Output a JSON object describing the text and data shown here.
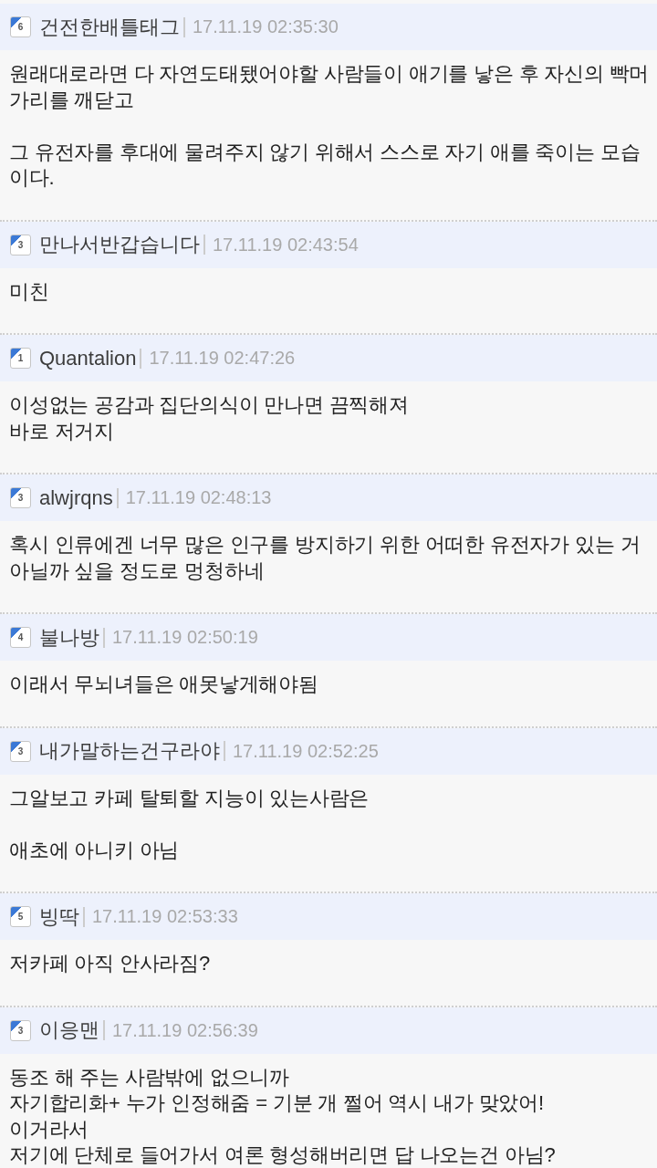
{
  "comments": [
    {
      "rank": "6",
      "author": "건전한배틀태그",
      "time": "17.11.19 02:35:30",
      "paragraphs": [
        [
          "원래대로라면 다 자연도태됐어야할 사람들이 애기를 낳은 후 자신의 빡머",
          "가리를 깨닫고"
        ],
        [
          "그 유전자를 후대에 물려주지 않기 위해서 스스로 자기 애를 죽이는 모습",
          "이다."
        ]
      ]
    },
    {
      "rank": "3",
      "author": "만나서반갑습니다",
      "time": "17.11.19 02:43:54",
      "paragraphs": [
        [
          "미친"
        ]
      ]
    },
    {
      "rank": "1",
      "author": "Quantalion",
      "time": "17.11.19 02:47:26",
      "paragraphs": [
        [
          "이성없는 공감과 집단의식이 만나면 끔찍해져",
          "바로 저거지"
        ]
      ]
    },
    {
      "rank": "3",
      "author": "alwjrqns",
      "time": "17.11.19 02:48:13",
      "paragraphs": [
        [
          "혹시 인류에겐 너무 많은 인구를 방지하기 위한 어떠한 유전자가 있는 거",
          "아닐까 싶을 정도로 멍청하네"
        ]
      ]
    },
    {
      "rank": "4",
      "author": "불나방",
      "time": "17.11.19 02:50:19",
      "paragraphs": [
        [
          "이래서 무뇌녀들은 애못낳게해야됨"
        ]
      ]
    },
    {
      "rank": "3",
      "author": "내가말하는건구라야",
      "time": "17.11.19 02:52:25",
      "paragraphs": [
        [
          "그알보고 카페 탈퇴할 지능이 있는사람은"
        ],
        [
          "애초에 아니키 아님"
        ]
      ]
    },
    {
      "rank": "5",
      "author": "빙딱",
      "time": "17.11.19 02:53:33",
      "paragraphs": [
        [
          "저카페 아직 안사라짐?"
        ]
      ]
    },
    {
      "rank": "3",
      "author": "이응맨",
      "time": "17.11.19 02:56:39",
      "paragraphs": [
        [
          "동조 해 주는 사람밖에 없으니까",
          "자기합리화+ 누가 인정해줌 = 기분 개 쩔어 역시 내가 맞았어!",
          "이거라서",
          "저기에 단체로 들어가서 여론 형성해버리면 답 나오는건 아님?"
        ]
      ]
    }
  ]
}
